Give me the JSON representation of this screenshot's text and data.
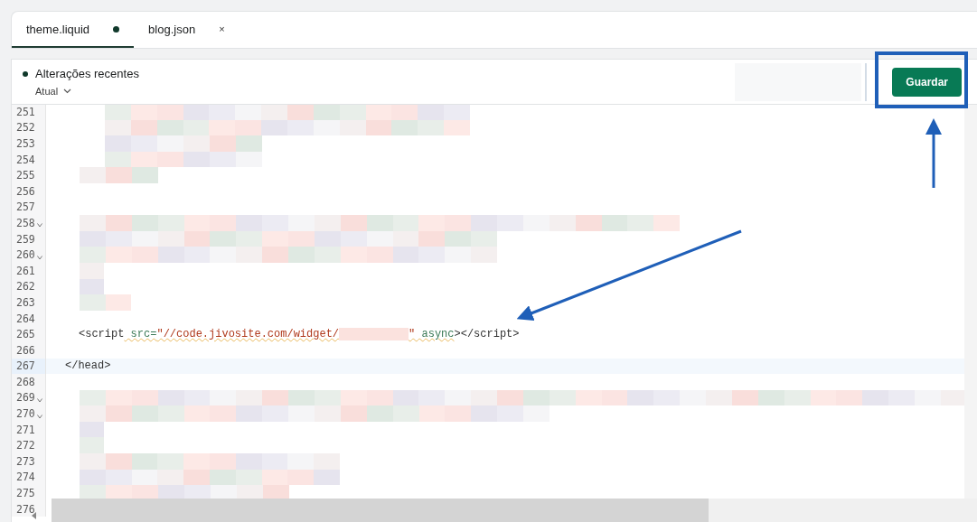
{
  "tabs": [
    {
      "label": "theme.liquid",
      "selected": true,
      "modified": true
    },
    {
      "label": "blog.json",
      "selected": false,
      "modified": false,
      "close": "×"
    }
  ],
  "toolbar": {
    "status": "Alterações recentes",
    "version": "Atual",
    "save_button": "Guardar"
  },
  "editor": {
    "lines": [
      {
        "number": "251",
        "kind": "blurred",
        "fold": false,
        "selected": false
      },
      {
        "number": "252",
        "kind": "blurred",
        "fold": false,
        "selected": false
      },
      {
        "number": "253",
        "kind": "blurred",
        "fold": false,
        "selected": false
      },
      {
        "number": "254",
        "kind": "blurred",
        "fold": false,
        "selected": false
      },
      {
        "number": "255",
        "kind": "blurred",
        "fold": false,
        "selected": false
      },
      {
        "number": "256",
        "kind": "blank",
        "fold": false,
        "selected": false
      },
      {
        "number": "257",
        "kind": "blank",
        "fold": false,
        "selected": false
      },
      {
        "number": "258",
        "kind": "blurred",
        "fold": true,
        "selected": false
      },
      {
        "number": "259",
        "kind": "blurred",
        "fold": false,
        "selected": false
      },
      {
        "number": "260",
        "kind": "blurred",
        "fold": true,
        "selected": false
      },
      {
        "number": "261",
        "kind": "blurred",
        "fold": false,
        "selected": false
      },
      {
        "number": "262",
        "kind": "blurred",
        "fold": false,
        "selected": false
      },
      {
        "number": "263",
        "kind": "blurred",
        "fold": false,
        "selected": false
      },
      {
        "number": "264",
        "kind": "blank",
        "fold": false,
        "selected": false
      },
      {
        "number": "265",
        "kind": "code",
        "fold": false,
        "selected": false,
        "segments": [
          {
            "kind": "tag",
            "text": "<script"
          },
          {
            "kind": "attr",
            "text": " src="
          },
          {
            "kind": "string",
            "text": "\"//code.jivosite.com/widget/"
          },
          {
            "kind": "redacted"
          },
          {
            "kind": "string",
            "text": "\""
          },
          {
            "kind": "attr",
            "text": " async"
          },
          {
            "kind": "tag",
            "text": "></script>"
          }
        ]
      },
      {
        "number": "266",
        "kind": "blank",
        "fold": false,
        "selected": false
      },
      {
        "number": "267",
        "kind": "code",
        "fold": false,
        "selected": true,
        "segments": [
          {
            "kind": "tag",
            "text": "</head>"
          }
        ]
      },
      {
        "number": "268",
        "kind": "blank",
        "fold": false,
        "selected": false
      },
      {
        "number": "269",
        "kind": "blurred",
        "fold": true,
        "selected": false
      },
      {
        "number": "270",
        "kind": "blurred",
        "fold": true,
        "selected": false
      },
      {
        "number": "271",
        "kind": "blurred",
        "fold": false,
        "selected": false
      },
      {
        "number": "272",
        "kind": "blurred",
        "fold": false,
        "selected": false
      },
      {
        "number": "273",
        "kind": "blurred",
        "fold": false,
        "selected": false
      },
      {
        "number": "274",
        "kind": "blurred",
        "fold": false,
        "selected": false
      },
      {
        "number": "275",
        "kind": "blurred",
        "fold": false,
        "selected": false
      },
      {
        "number": "276",
        "kind": "blank",
        "fold": false,
        "selected": false
      }
    ]
  }
}
